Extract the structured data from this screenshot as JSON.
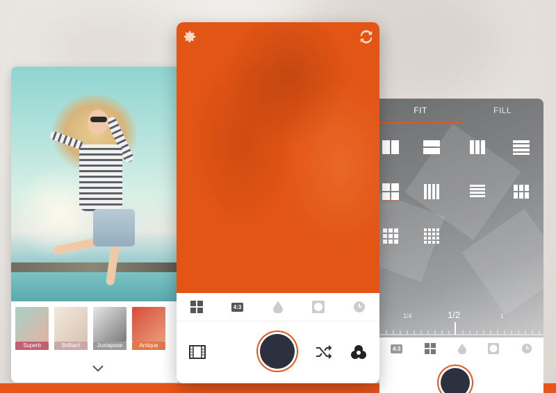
{
  "colors": {
    "accent": "#e8551b",
    "camera_view": "#e25515",
    "shutter": "#2c3140"
  },
  "left_screen": {
    "filters": [
      {
        "label": "Superb",
        "color": "#c06070"
      },
      {
        "label": "Brilliant",
        "color": "#c8a8a8"
      },
      {
        "label": "Juxtapose",
        "color": "#9a9a9a"
      },
      {
        "label": "Antique",
        "color": "#e0784a"
      }
    ],
    "expand_icon": "chevron-down-icon"
  },
  "center_screen": {
    "top_icons": [
      "gear-icon",
      "rotate-camera-icon"
    ],
    "toolbar": {
      "ratio_label": "4:3",
      "icons": [
        "grid-icon",
        "aspect-ratio-icon",
        "drop-icon",
        "vignette-icon",
        "timer-icon"
      ]
    },
    "bottom_icons": [
      "film-icon",
      "shutter-button",
      "shuffle-icon",
      "color-filter-icon"
    ]
  },
  "right_screen": {
    "tabs": [
      {
        "label": "FIT",
        "active": true
      },
      {
        "label": "FILL",
        "active": false
      }
    ],
    "ruler": {
      "left_label": "1/4",
      "center_label": "1/2",
      "right_label": "1"
    },
    "toolbar": {
      "ratio_label": "4:3"
    }
  }
}
